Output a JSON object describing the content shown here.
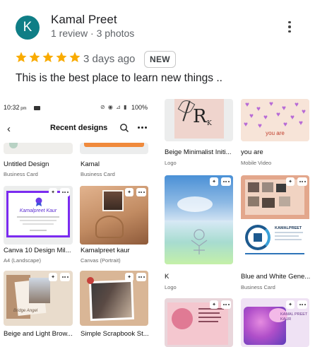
{
  "review": {
    "avatar_letter": "K",
    "avatar_color": "#0f7e86",
    "reviewer_name": "Kamal Preet",
    "reviewer_meta": "1 review · 3 photos",
    "rating": 5,
    "star_color": "#f9ab00",
    "date": "3 days ago",
    "badge": "NEW",
    "text": "This is the best place to learn new things .."
  },
  "photo1": {
    "status_time": "10:32",
    "status_ampm": "pm",
    "status_battery": "100%",
    "header_title": "Recent designs",
    "designs": [
      {
        "title": "Untitled Design",
        "type": "Business Card"
      },
      {
        "title": "Kamal",
        "type": "Business Card"
      },
      {
        "title": "Canva 10 Design Mil...",
        "type": "A4 (Landscape)",
        "cert_title": "Kamalpreet Kaur"
      },
      {
        "title": "Kamalpreet kaur",
        "type": "Canvas (Portrait)"
      },
      {
        "title": "Beige and Light Brow...",
        "type": ""
      },
      {
        "title": "Simple Scrapbook St...",
        "type": ""
      }
    ]
  },
  "photo2": {
    "designs": [
      {
        "title": "Beige Minimalist Initi...",
        "type": "Logo",
        "logo_letter": "R",
        "logo_small": "K"
      },
      {
        "title": "you are",
        "type": "Mobile Video",
        "overlay_text": "you are"
      },
      {
        "title": "K",
        "type": "Logo"
      },
      {
        "title": "Blue and White Gene...",
        "type": "Business Card",
        "card_name": "KAMALPREET"
      },
      {
        "title": "",
        "type": ""
      },
      {
        "title": "",
        "type": ""
      }
    ]
  }
}
